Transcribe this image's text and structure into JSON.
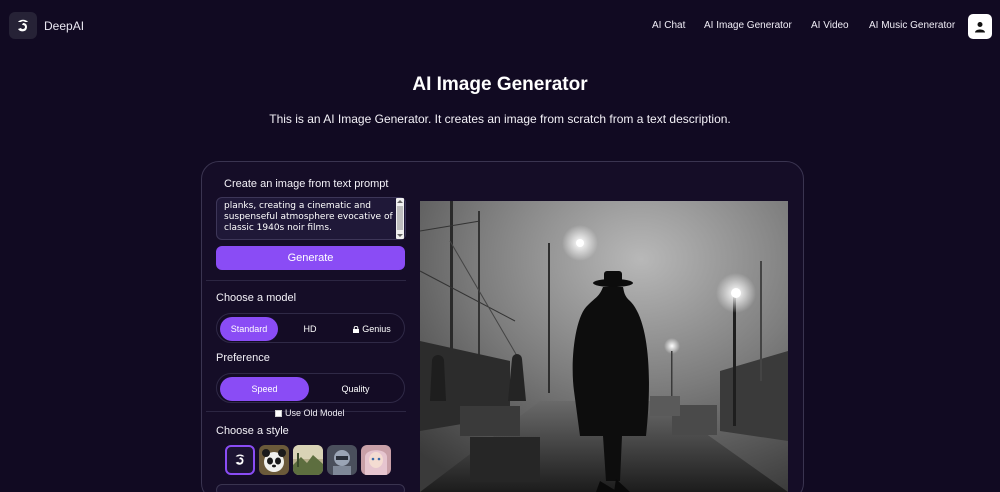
{
  "header": {
    "brand": "DeepAI",
    "nav": [
      "AI Chat",
      "AI Image Generator",
      "AI Video",
      "AI Music Generator"
    ]
  },
  "page": {
    "title": "AI Image Generator",
    "subtitle": "This is an AI Image Generator. It creates an image from scratch from a text description."
  },
  "form": {
    "prompt_label": "Create an image from text prompt",
    "prompt_value": "planks, creating a cinematic and suspenseful atmosphere evocative of classic 1940s noir films.",
    "generate_label": "Generate",
    "model_label": "Choose a model",
    "models": [
      "Standard",
      "HD",
      "Genius"
    ],
    "selected_model": "Standard",
    "preference_label": "Preference",
    "preferences": [
      "Speed",
      "Quality"
    ],
    "selected_preference": "Speed",
    "old_model_label": "Use Old Model",
    "style_label": "Choose a style",
    "styles": [
      "default-style",
      "panda-style",
      "landscape-style",
      "robot-style",
      "anime-portrait-style"
    ]
  },
  "colors": {
    "background": "#110a22",
    "accent": "#8a4cf5",
    "panel_border": "#3a3450"
  },
  "result": {
    "description_icon": "noir-image"
  }
}
